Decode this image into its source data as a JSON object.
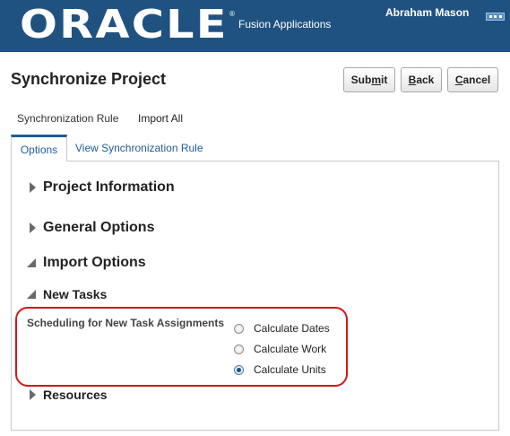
{
  "header": {
    "logo_text": "ORACLE",
    "logo_reg_mark": "®",
    "product_name": "Fusion Applications",
    "user_name": "Abraham Mason",
    "menu_icon": "global-menu-icon"
  },
  "page": {
    "title": "Synchronize Project"
  },
  "buttons": {
    "submit": {
      "before": "Sub",
      "accel": "m",
      "after": "it"
    },
    "back": {
      "before": "",
      "accel": "B",
      "after": "ack"
    },
    "cancel": {
      "before": "",
      "accel": "C",
      "after": "ancel"
    }
  },
  "subnav": {
    "items": [
      "Synchronization Rule",
      "Import All"
    ]
  },
  "tabs": [
    {
      "label": "Options",
      "selected": true
    },
    {
      "label": "View Synchronization Rule",
      "selected": false
    }
  ],
  "sections": {
    "project_information": {
      "label": "Project Information",
      "expanded": false
    },
    "general_options": {
      "label": "General Options",
      "expanded": false
    },
    "import_options": {
      "label": "Import Options",
      "expanded": true
    },
    "new_tasks": {
      "label": "New Tasks",
      "expanded": true
    },
    "resources": {
      "label": "Resources",
      "expanded": false
    }
  },
  "scheduling": {
    "label": "Scheduling for New Task Assignments",
    "options": [
      {
        "label": "Calculate Dates",
        "checked": false
      },
      {
        "label": "Calculate Work",
        "checked": false
      },
      {
        "label": "Calculate Units",
        "checked": true
      }
    ]
  },
  "colors": {
    "header_bg": "#1f5280",
    "link_blue": "#1f5d99",
    "highlight_red": "#d0181b"
  }
}
